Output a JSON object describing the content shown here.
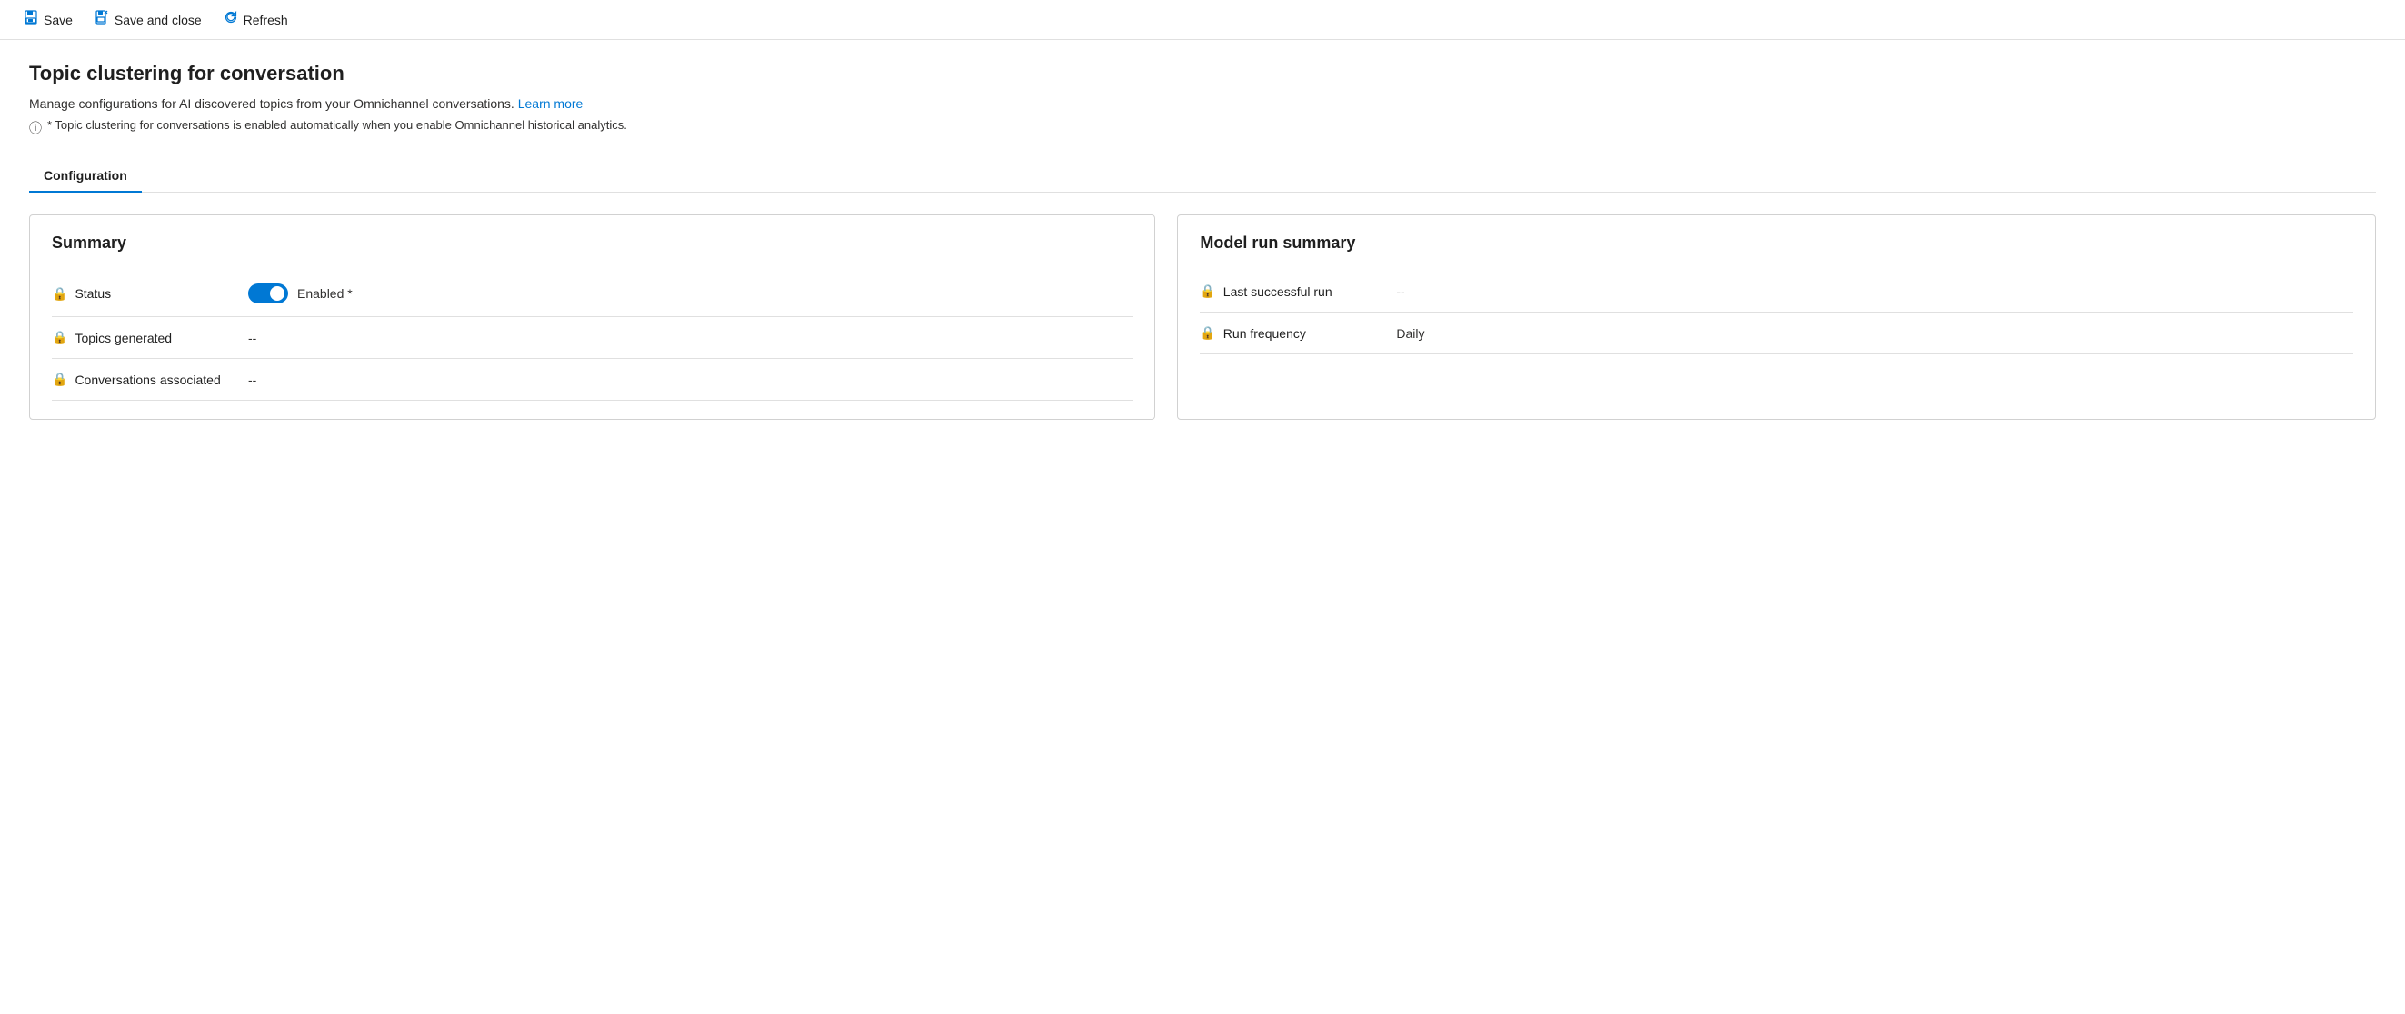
{
  "toolbar": {
    "save_label": "Save",
    "save_and_close_label": "Save and close",
    "refresh_label": "Refresh"
  },
  "page": {
    "title": "Topic clustering for conversation",
    "description": "Manage configurations for AI discovered topics from your Omnichannel conversations.",
    "learn_more_label": "Learn more",
    "note": "* Topic clustering for conversations is enabled automatically when you enable Omnichannel historical analytics."
  },
  "tabs": [
    {
      "label": "Configuration",
      "active": true
    }
  ],
  "summary_card": {
    "title": "Summary",
    "fields": [
      {
        "label": "Status",
        "type": "toggle",
        "toggle_value": "on",
        "toggle_text": "Enabled *"
      },
      {
        "label": "Topics generated",
        "value": "--"
      },
      {
        "label": "Conversations associated",
        "value": "--"
      }
    ]
  },
  "model_run_card": {
    "title": "Model run summary",
    "fields": [
      {
        "label": "Last successful run",
        "value": "--"
      },
      {
        "label": "Run frequency",
        "value": "Daily"
      }
    ]
  }
}
